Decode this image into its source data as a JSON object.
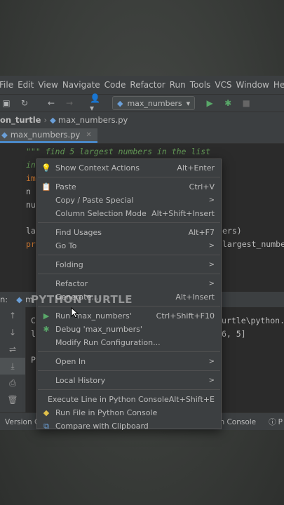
{
  "menubar": {
    "items": [
      "File",
      "Edit",
      "View",
      "Navigate",
      "Code",
      "Refactor",
      "Run",
      "Tools",
      "VCS",
      "Window",
      "Help"
    ]
  },
  "toolbar": {
    "run_config": "max_numbers"
  },
  "breadcrumb": {
    "project": "on_turtle",
    "file": "max_numbers.py"
  },
  "tabs": [
    {
      "label": "max_numbers.py"
    }
  ],
  "editor": {
    "lines": [
      "\"\"\" find 5 largest numbers in the list",
      "in",
      "im",
      "n",
      "nu",
      "la",
      "pr"
    ],
    "right_fragments": [
      "ers)",
      "largest_number"
    ]
  },
  "run_panel": {
    "label": "n:",
    "tab": "m",
    "output": [
      "C",
      "l",
      "P"
    ],
    "right_fragments": [
      "urtle\\python.",
      "6, 5]"
    ]
  },
  "statusbar": {
    "left": "Version Co",
    "right": "ython Console",
    "right_end": "P"
  },
  "watermark": "PYTHON TURTLE",
  "context_menu": {
    "items": [
      {
        "label": "Show Context Actions",
        "shortcut": "Alt+Enter",
        "icon": "bulb-icon"
      },
      {
        "label": "Paste",
        "shortcut": "Ctrl+V",
        "icon": "paste-icon"
      },
      {
        "label": "Copy / Paste Special",
        "shortcut": "",
        "icon": "",
        "submenu": true
      },
      {
        "label": "Column Selection Mode",
        "shortcut": "Alt+Shift+Insert",
        "icon": ""
      },
      {
        "label": "Find Usages",
        "shortcut": "Alt+F7",
        "icon": ""
      },
      {
        "label": "Go To",
        "shortcut": "",
        "icon": "",
        "submenu": true
      },
      {
        "label": "Folding",
        "shortcut": "",
        "icon": "",
        "submenu": true
      },
      {
        "label": "Refactor",
        "shortcut": "",
        "icon": "",
        "submenu": true
      },
      {
        "label": "Generate...",
        "shortcut": "Alt+Insert",
        "icon": ""
      },
      {
        "label": "Run 'max_numbers'",
        "shortcut": "Ctrl+Shift+F10",
        "icon": "run-icon"
      },
      {
        "label": "Debug 'max_numbers'",
        "shortcut": "",
        "icon": "debug-icon"
      },
      {
        "label": "Modify Run Configuration...",
        "shortcut": "",
        "icon": ""
      },
      {
        "label": "Open In",
        "shortcut": "",
        "icon": "",
        "submenu": true
      },
      {
        "label": "Local History",
        "shortcut": "",
        "icon": "",
        "submenu": true
      },
      {
        "label": "Execute Line in Python Console",
        "shortcut": "Alt+Shift+E",
        "icon": ""
      },
      {
        "label": "Run File in Python Console",
        "shortcut": "",
        "icon": "python-icon"
      },
      {
        "label": "Compare with Clipboard",
        "shortcut": "",
        "icon": "compare-icon"
      }
    ]
  },
  "colors": {
    "accent": "#4a88c7",
    "run_green": "#59a869",
    "docstring": "#629755",
    "keyword": "#cc7832"
  }
}
